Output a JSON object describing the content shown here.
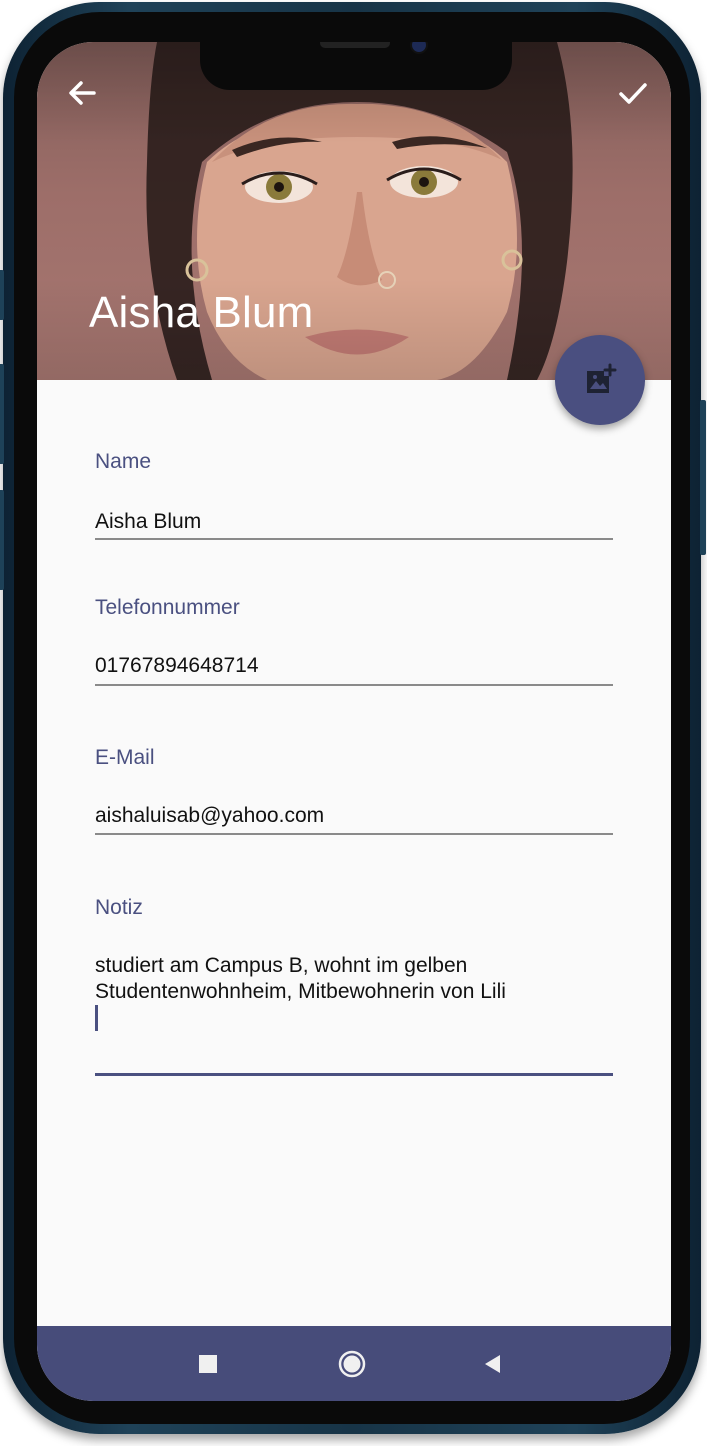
{
  "header": {
    "contact_name": "Aisha Blum",
    "back_icon": "arrow-back-icon",
    "save_icon": "check-icon",
    "fab_icon": "add-photo-icon"
  },
  "form": {
    "name": {
      "label": "Name",
      "value": "Aisha Blum"
    },
    "phone": {
      "label": "Telefonnummer",
      "value": "01767894648714"
    },
    "email": {
      "label": "E-Mail",
      "value": "aishaluisab@yahoo.com"
    },
    "note": {
      "label": "Notiz",
      "value_line1": "studiert am Campus B, wohnt im gelben",
      "value_line2": "Studentenwohnheim, Mitbewohnerin von Lili"
    }
  },
  "navbar": {
    "recents_icon": "square-recents-icon",
    "home_icon": "circle-home-icon",
    "back_icon": "triangle-back-icon"
  },
  "colors": {
    "accent": "#4a5080",
    "navbar": "#474c7a",
    "header_bg": "#9d6e69"
  }
}
